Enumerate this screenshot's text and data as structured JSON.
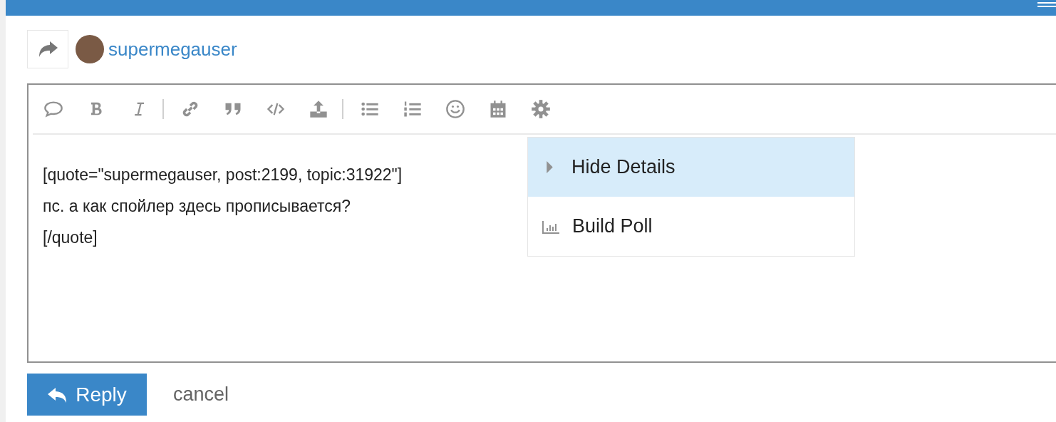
{
  "reply_to": {
    "username": "supermegauser"
  },
  "editor": {
    "value": "[quote=\"supermegauser, post:2199, topic:31922\"]\nпс. а как спойлер здесь прописывается?\n[/quote]"
  },
  "menu": {
    "items": [
      {
        "label": "Hide Details",
        "kind": "details",
        "selected": true
      },
      {
        "label": "Build Poll",
        "kind": "poll",
        "selected": false
      }
    ]
  },
  "buttons": {
    "reply": "Reply",
    "cancel": "cancel"
  }
}
